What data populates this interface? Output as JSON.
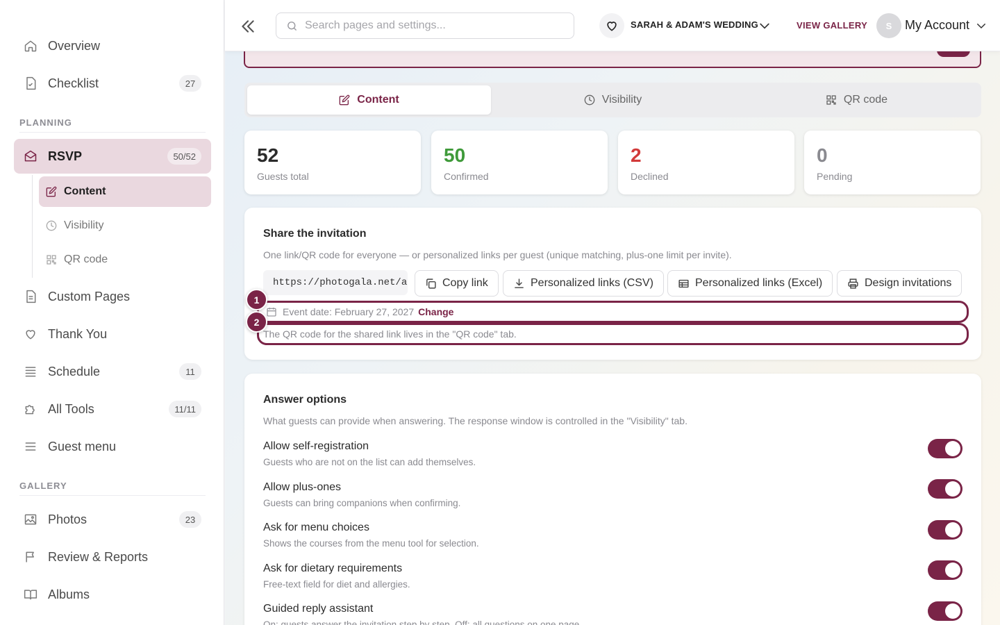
{
  "sidebar": {
    "items": [
      {
        "label": "Overview",
        "count": ""
      },
      {
        "label": "Checklist",
        "count": "27"
      },
      {
        "label": "RSVP",
        "count": "50/52"
      },
      {
        "label": "Custom Pages",
        "count": ""
      },
      {
        "label": "Thank You",
        "count": ""
      },
      {
        "label": "Schedule",
        "count": "11"
      },
      {
        "label": "All Tools",
        "count": "11/11"
      },
      {
        "label": "Guest menu",
        "count": ""
      },
      {
        "label": "Photos",
        "count": "23"
      },
      {
        "label": "Review & Reports",
        "count": ""
      },
      {
        "label": "Albums",
        "count": ""
      }
    ],
    "sections": {
      "planning": "PLANNING",
      "gallery": "GALLERY"
    },
    "sub_items": [
      {
        "label": "Content"
      },
      {
        "label": "Visibility"
      },
      {
        "label": "QR code"
      }
    ]
  },
  "topbar": {
    "search_placeholder": "Search pages and settings...",
    "event_name": "SARAH & ADAM'S WEDDING",
    "view_gallery": "VIEW GALLERY",
    "avatar_initial": "S",
    "account_label": "My Account"
  },
  "tabs": [
    {
      "label": "Content",
      "active": true
    },
    {
      "label": "Visibility",
      "active": false
    },
    {
      "label": "QR code",
      "active": false
    }
  ],
  "stats": [
    {
      "value": "52",
      "label": "Guests total",
      "color": "#222222"
    },
    {
      "value": "50",
      "label": "Confirmed",
      "color": "#3f9a3a"
    },
    {
      "value": "2",
      "label": "Declined",
      "color": "#d23a3a"
    },
    {
      "value": "0",
      "label": "Pending",
      "color": "#8a8a90"
    }
  ],
  "share": {
    "title": "Share the invitation",
    "description": "One link/QR code for everyone — or personalized links per guest (unique matching, plus-one limit per invite).",
    "link": "https://photogala.net/a…",
    "buttons": {
      "copy": "Copy link",
      "csv": "Personalized links (CSV)",
      "excel": "Personalized links (Excel)",
      "design": "Design invitations"
    },
    "event_date": "Event date: February 27, 2027",
    "change": "Change",
    "qr_hint": "The QR code for the shared link lives in the \"QR code\" tab.",
    "markers": [
      "1",
      "2"
    ]
  },
  "answers": {
    "title": "Answer options",
    "description": "What guests can provide when answering. The response window is controlled in the \"Visibility\" tab.",
    "options": [
      {
        "title": "Allow self-registration",
        "subtitle": "Guests who are not on the list can add themselves.",
        "on": true
      },
      {
        "title": "Allow plus-ones",
        "subtitle": "Guests can bring companions when confirming.",
        "on": true
      },
      {
        "title": "Ask for menu choices",
        "subtitle": "Shows the courses from the menu tool for selection.",
        "on": true
      },
      {
        "title": "Ask for dietary requirements",
        "subtitle": "Free-text field for diet and allergies.",
        "on": true
      },
      {
        "title": "Guided reply assistant",
        "subtitle": "On: guests answer the invitation step by step. Off: all questions on one page.",
        "on": true
      }
    ]
  },
  "colors": {
    "accent": "#7a2447",
    "accent_light": "#ead8df"
  }
}
